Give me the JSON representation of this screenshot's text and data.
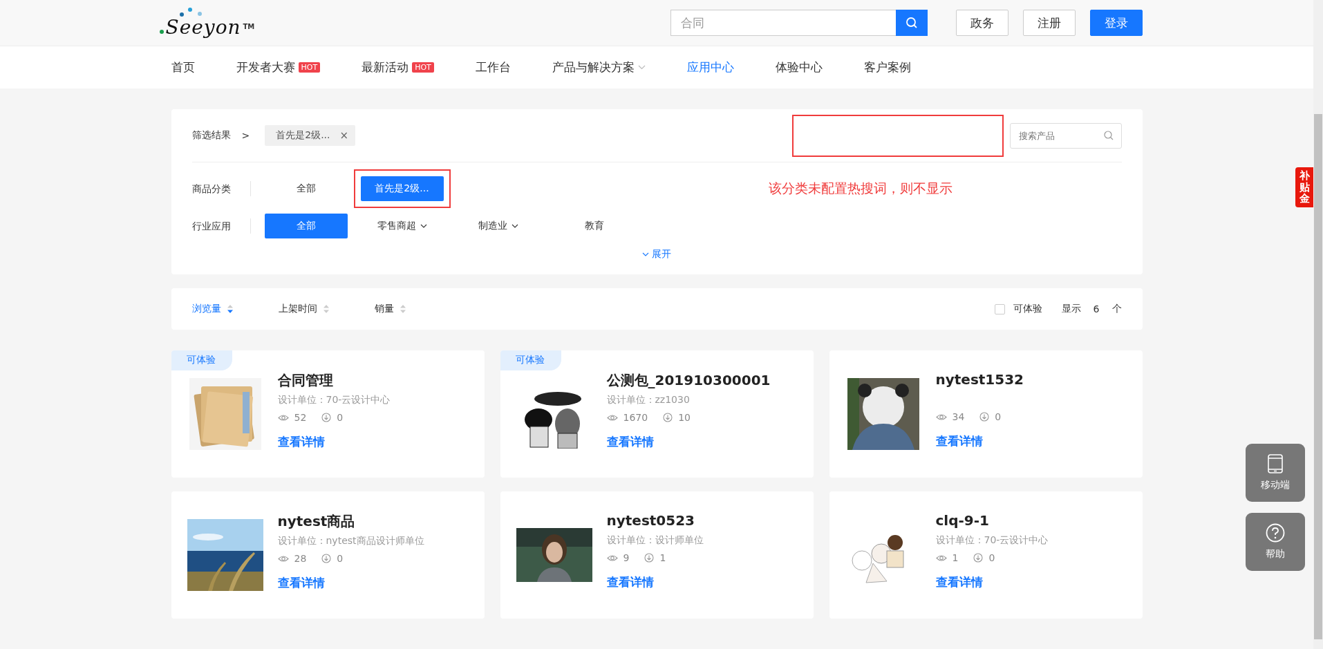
{
  "header": {
    "logo": {
      "text": "Seeyon",
      "mark": "TM"
    },
    "search": {
      "value": "合同"
    },
    "buttons": [
      {
        "label": "政务",
        "kind": "outline"
      },
      {
        "label": "注册",
        "kind": "outline"
      },
      {
        "label": "登录",
        "kind": "primary"
      }
    ]
  },
  "nav": [
    {
      "label": "首页",
      "selected": false
    },
    {
      "label": "开发者大赛",
      "badge": "HOT",
      "selected": false
    },
    {
      "label": "最新活动",
      "badge": "HOT",
      "selected": false
    },
    {
      "label": "工作台",
      "selected": false
    },
    {
      "label": "产品与解决方案",
      "dropdown": true,
      "selected": false
    },
    {
      "label": "应用中心",
      "selected": true
    },
    {
      "label": "体验中心",
      "selected": false
    },
    {
      "label": "客户案例",
      "selected": false
    }
  ],
  "filter": {
    "result_label": "筛选结果",
    "separator": ">",
    "chips": [
      {
        "label": "首先是2级...",
        "close": "×"
      }
    ],
    "search": {
      "placeholder": "搜索产品"
    },
    "annotation": "该分类未配置热搜词，则不显示",
    "rows": [
      {
        "label": "商品分类",
        "options": [
          {
            "label": "全部",
            "selected": false
          },
          {
            "label": "首先是2级...",
            "selected": true,
            "highlighted": true
          }
        ]
      },
      {
        "label": "行业应用",
        "options": [
          {
            "label": "全部",
            "selected": true
          },
          {
            "label": "零售商超",
            "dropdown": true,
            "selected": false
          },
          {
            "label": "制造业",
            "dropdown": true,
            "selected": false
          },
          {
            "label": "教育",
            "selected": false
          }
        ]
      }
    ],
    "expand": "展开"
  },
  "sort": {
    "items": [
      {
        "label": "浏览量",
        "selected": true
      },
      {
        "label": "上架时间",
        "selected": false
      },
      {
        "label": "销量",
        "selected": false
      }
    ],
    "trial": {
      "label": "可体验",
      "checked": false
    },
    "show_label": "显示",
    "count": "6",
    "unit": "个"
  },
  "products": [
    {
      "tag": "可体验",
      "title": "合同管理",
      "designer": "设计单位：70-云设计中心",
      "views": "52",
      "downloads": "0",
      "link": "查看详情",
      "kind": "picture"
    },
    {
      "tag": "可体验",
      "title": "公测包_201910300001",
      "designer": "设计单位：zz1030",
      "views": "1670",
      "downloads": "10",
      "link": "查看详情",
      "kind": "picture"
    },
    {
      "title": "nytest1532",
      "views": "34",
      "downloads": "0",
      "link": "查看详情",
      "kind": "picture"
    },
    {
      "title": "nytest商品",
      "designer": "设计单位：nytest商品设计师单位",
      "views": "28",
      "downloads": "0",
      "link": "查看详情",
      "kind": "picture"
    },
    {
      "title": "nytest0523",
      "designer": "设计单位：设计师单位",
      "views": "9",
      "downloads": "1",
      "link": "查看详情",
      "kind": "picture"
    },
    {
      "title": "clq-9-1",
      "designer": "设计单位：70-云设计中心",
      "views": "1",
      "downloads": "0",
      "link": "查看详情",
      "kind": "picture"
    }
  ],
  "side": {
    "promo": "补贴金",
    "buttons": [
      {
        "label": "移动端",
        "kind": "mobile"
      },
      {
        "label": "帮助",
        "kind": "help"
      }
    ]
  }
}
